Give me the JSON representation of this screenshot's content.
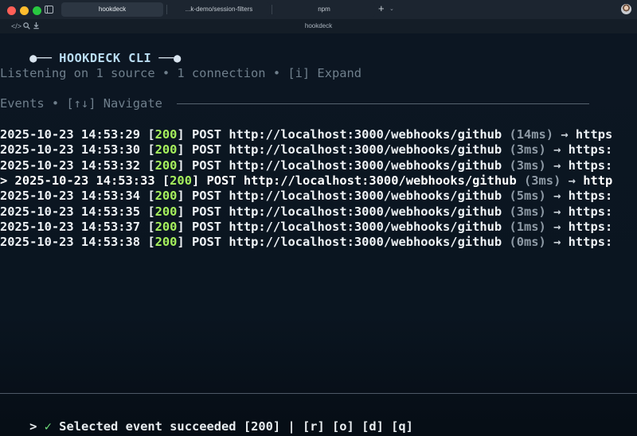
{
  "window": {
    "tabs": [
      {
        "label": "hookdeck",
        "active": true
      },
      {
        "label": "...k-demo/session-filters",
        "active": false
      },
      {
        "label": "npm",
        "active": false
      }
    ],
    "new_tab": "+",
    "tab_menu": "⌄",
    "subtitle": "hookdeck",
    "tool_icons": [
      "code-icon",
      "search-icon",
      "download-icon"
    ]
  },
  "terminal": {
    "banner": {
      "left": "●── ",
      "title": "HOOKDECK CLI",
      "right": " ──●"
    },
    "status_line": "Listening on 1 source • 1 connection • [i] Expand",
    "events_header": "Events • [↑↓] Navigate",
    "events": [
      {
        "prefix": "",
        "timestamp": "2025-10-23 14:53:29",
        "status": "200",
        "method": "POST",
        "url": "http://localhost:3000/webhooks/github",
        "duration": "(14ms)",
        "arrow": "→",
        "dest": "https"
      },
      {
        "prefix": "",
        "timestamp": "2025-10-23 14:53:30",
        "status": "200",
        "method": "POST",
        "url": "http://localhost:3000/webhooks/github",
        "duration": "(3ms)",
        "arrow": "→",
        "dest": "https:"
      },
      {
        "prefix": "",
        "timestamp": "2025-10-23 14:53:32",
        "status": "200",
        "method": "POST",
        "url": "http://localhost:3000/webhooks/github",
        "duration": "(3ms)",
        "arrow": "→",
        "dest": "https:"
      },
      {
        "prefix": "> ",
        "timestamp": "2025-10-23 14:53:33",
        "status": "200",
        "method": "POST",
        "url": "http://localhost:3000/webhooks/github",
        "duration": "(3ms)",
        "arrow": "→",
        "dest": "http"
      },
      {
        "prefix": "",
        "timestamp": "2025-10-23 14:53:34",
        "status": "200",
        "method": "POST",
        "url": "http://localhost:3000/webhooks/github",
        "duration": "(5ms)",
        "arrow": "→",
        "dest": "https:"
      },
      {
        "prefix": "",
        "timestamp": "2025-10-23 14:53:35",
        "status": "200",
        "method": "POST",
        "url": "http://localhost:3000/webhooks/github",
        "duration": "(3ms)",
        "arrow": "→",
        "dest": "https:"
      },
      {
        "prefix": "",
        "timestamp": "2025-10-23 14:53:37",
        "status": "200",
        "method": "POST",
        "url": "http://localhost:3000/webhooks/github",
        "duration": "(1ms)",
        "arrow": "→",
        "dest": "https:"
      },
      {
        "prefix": "",
        "timestamp": "2025-10-23 14:53:38",
        "status": "200",
        "method": "POST",
        "url": "http://localhost:3000/webhooks/github",
        "duration": "(0ms)",
        "arrow": "→",
        "dest": "https:"
      }
    ],
    "footer": {
      "prompt": "> ",
      "check": "✓",
      "message": " Selected event succeeded [200] | [r] [o] [d] [q]"
    }
  },
  "colors": {
    "status_ok": "#a6f05d",
    "background": "#0b1622",
    "banner_title": "#b9dcf2"
  }
}
